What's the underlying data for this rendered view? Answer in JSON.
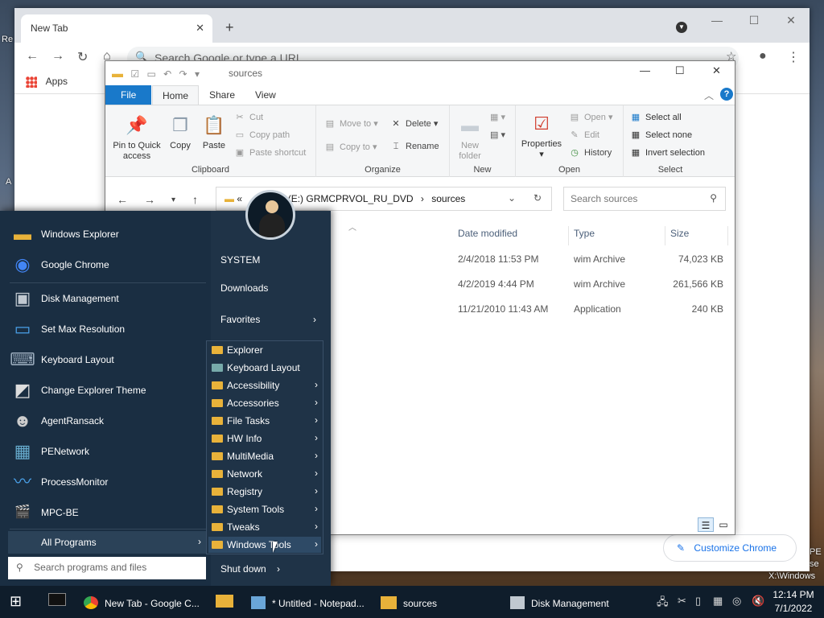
{
  "desktop": {
    "left_text1": "Re",
    "left_text2": "A",
    "right_text1": "PE",
    "right_text2": "se",
    "right_text3": "X:\\Windows"
  },
  "chrome": {
    "tab_title": "New Tab",
    "tab_close": "✕",
    "new_tab": "+",
    "omnibox_placeholder": "Search Google or type a URL",
    "bookmark_apps": "Apps",
    "customize_label": "Customize Chrome"
  },
  "explorer": {
    "title": "sources",
    "ribbon_tabs": {
      "file": "File",
      "home": "Home",
      "share": "Share",
      "view": "View"
    },
    "clipboard": {
      "pin": "Pin to Quick access",
      "copy": "Copy",
      "paste": "Paste",
      "cut": "Cut",
      "copy_path": "Copy path",
      "paste_shortcut": "Paste shortcut",
      "label": "Clipboard"
    },
    "organize": {
      "move_to": "Move to",
      "copy_to": "Copy to",
      "delete": "Delete",
      "rename": "Rename",
      "label": "Organize"
    },
    "new_group": {
      "new_folder": "New folder",
      "label": "New"
    },
    "open_group": {
      "properties": "Properties",
      "open": "Open",
      "edit": "Edit",
      "history": "History",
      "label": "Open"
    },
    "select_group": {
      "select_all": "Select all",
      "select_none": "Select none",
      "invert": "Invert selection",
      "label": "Select"
    },
    "address": {
      "path_prefix": "«",
      "drive": "(E:) GRMCPRVOL_RU_DVD",
      "folder": "sources",
      "sep": "›"
    },
    "search_placeholder": "Search sources",
    "columns": {
      "date": "Date modified",
      "type": "Type",
      "size": "Size"
    },
    "files": [
      {
        "date": "2/4/2018 11:53 PM",
        "type": "wim Archive",
        "size": "74,023 KB"
      },
      {
        "date": "4/2/2019 4:44 PM",
        "type": "wim Archive",
        "size": "261,566 KB"
      },
      {
        "date": "11/21/2010 11:43 AM",
        "type": "Application",
        "size": "240 KB"
      }
    ]
  },
  "startmenu": {
    "programs": [
      "Windows Explorer",
      "Google Chrome",
      "Disk Management",
      "Set Max Resolution",
      "Keyboard Layout",
      "Change Explorer Theme",
      "AgentRansack",
      "PENetwork",
      "ProcessMonitor",
      "MPC-BE"
    ],
    "all_programs": "All Programs",
    "search_placeholder": "Search programs and files",
    "right_links": {
      "system": "SYSTEM",
      "downloads": "Downloads",
      "favorites": "Favorites",
      "shutdown": "Shut down"
    }
  },
  "submenu": {
    "items": [
      "Explorer",
      "Keyboard Layout",
      "Accessibility",
      "Accessories",
      "File Tasks",
      "HW Info",
      "MultiMedia",
      "Network",
      "Registry",
      "System Tools",
      "Tweaks",
      "Windows Tools"
    ]
  },
  "taskbar": {
    "chrome": "New Tab - Google C...",
    "notepad": "* Untitled - Notepad...",
    "explorer": "sources",
    "diskmgmt": "Disk Management",
    "time": "12:14 PM",
    "date": "7/1/2022"
  },
  "colors": {
    "accent": "#1979ca",
    "startmenu_bg": "#1f3347",
    "taskbar_bg": "#0f1d2b",
    "folder": "#e8b23a"
  }
}
